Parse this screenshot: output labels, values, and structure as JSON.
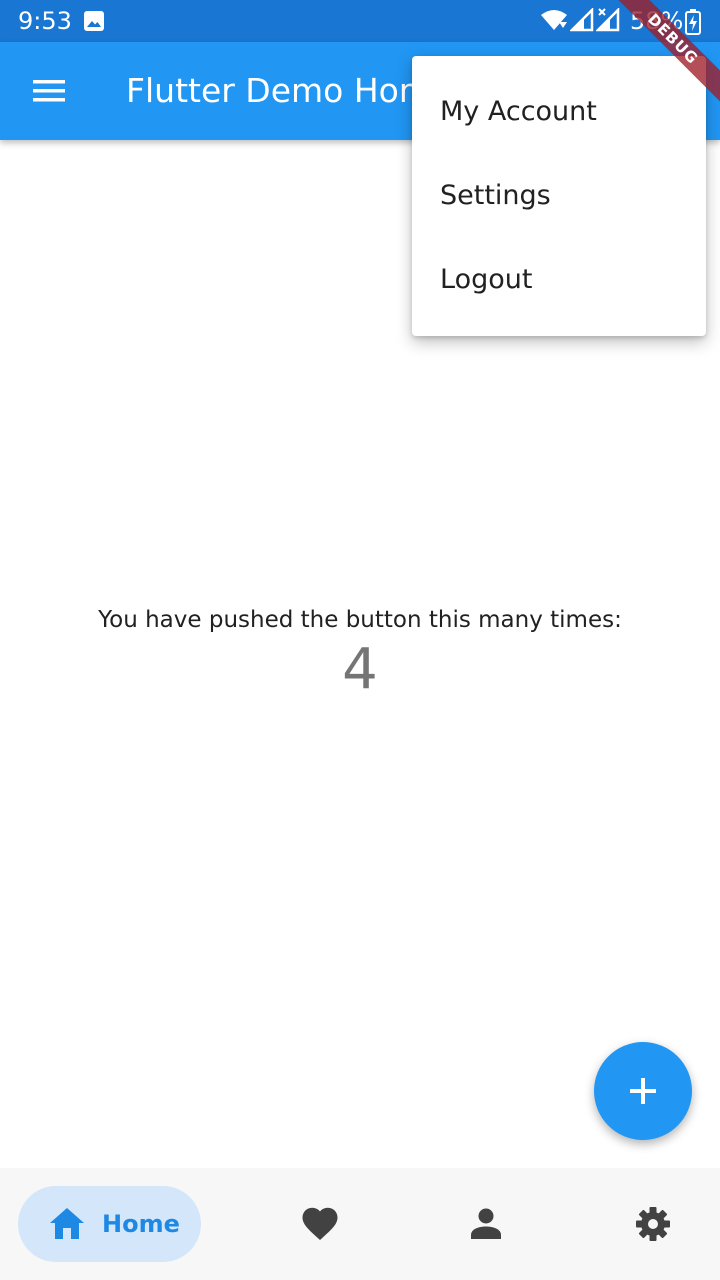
{
  "status_bar": {
    "time": "9:53",
    "battery": "58%",
    "icons": [
      "gallery-icon",
      "wifi-icon",
      "signal-icon",
      "signal-x-icon",
      "battery-charging-icon"
    ]
  },
  "app_bar": {
    "title": "Flutter Demo Home Page",
    "menu_icon": "hamburger-menu-icon"
  },
  "debug_banner": "DEBUG",
  "popup_menu": {
    "items": [
      {
        "label": "My Account"
      },
      {
        "label": "Settings"
      },
      {
        "label": "Logout"
      }
    ]
  },
  "body": {
    "counter_label": "You have pushed the button this many times:",
    "counter_value": "4"
  },
  "fab": {
    "icon": "plus-icon"
  },
  "bottom_nav": {
    "items": [
      {
        "label": "Home",
        "icon": "home-icon",
        "selected": true
      },
      {
        "label": "",
        "icon": "heart-icon",
        "selected": false
      },
      {
        "label": "",
        "icon": "person-icon",
        "selected": false
      },
      {
        "label": "",
        "icon": "gear-icon",
        "selected": false
      }
    ]
  },
  "colors": {
    "status_bar": "#1976d2",
    "app_bar": "#2196f3",
    "fab": "#2196f3",
    "selected_nav_bg": "#d4e6f9",
    "selected_nav_fg": "#1e88e5",
    "nav_icon": "#424242"
  }
}
